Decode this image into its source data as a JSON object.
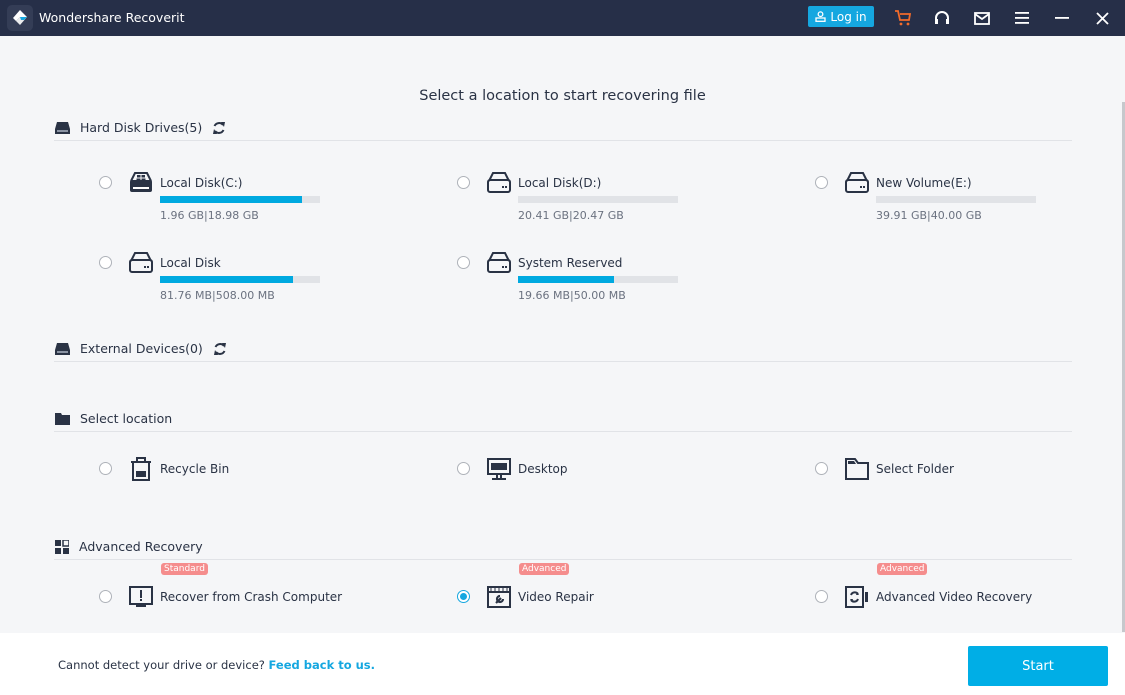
{
  "app": {
    "title": "Wondershare Recoverit"
  },
  "titlebar": {
    "login_label": "Log in",
    "icons": [
      "user-icon",
      "cart-icon",
      "headset-icon",
      "mail-icon",
      "menu-icon",
      "minimize-icon",
      "close-icon"
    ],
    "accent": "#15a7e0",
    "cart_color": "#f26b2a"
  },
  "main": {
    "heading": "Select a location to start recovering file"
  },
  "hard_disks": {
    "title": "Hard Disk Drives(5)",
    "drives": [
      {
        "name": "Local Disk(C:)",
        "used": "1.96 GB",
        "total": "18.98 GB",
        "size_text": "1.96 GB|18.98 GB",
        "fill_fraction": 0.89,
        "icon": "windows-drive-icon"
      },
      {
        "name": "Local Disk(D:)",
        "used": "20.41 GB",
        "total": "20.47 GB",
        "size_text": "20.41 GB|20.47 GB",
        "fill_fraction": 0.0,
        "icon": "hard-drive-icon"
      },
      {
        "name": "New Volume(E:)",
        "used": "39.91 GB",
        "total": "40.00 GB",
        "size_text": "39.91 GB|40.00 GB",
        "fill_fraction": 0.0,
        "icon": "hard-drive-icon"
      },
      {
        "name": "Local Disk",
        "used": "81.76 MB",
        "total": "508.00 MB",
        "size_text": "81.76 MB|508.00 MB",
        "fill_fraction": 0.83,
        "icon": "hard-drive-icon"
      },
      {
        "name": "System Reserved",
        "used": "19.66 MB",
        "total": "50.00 MB",
        "size_text": "19.66 MB|50.00 MB",
        "fill_fraction": 0.6,
        "icon": "hard-drive-icon"
      }
    ]
  },
  "external": {
    "title": "External Devices(0)"
  },
  "select_location": {
    "title": "Select location",
    "items": [
      {
        "label": "Recycle Bin"
      },
      {
        "label": "Desktop"
      },
      {
        "label": "Select Folder"
      }
    ]
  },
  "advanced": {
    "title": "Advanced Recovery",
    "items": [
      {
        "label": "Recover from Crash Computer",
        "badge": "Standard",
        "selected": false
      },
      {
        "label": "Video Repair",
        "badge": "Advanced",
        "selected": true
      },
      {
        "label": "Advanced Video Recovery",
        "badge": "Advanced",
        "selected": false
      }
    ]
  },
  "footer": {
    "text": "Cannot detect your drive or device?",
    "link": "Feed back to us.",
    "start_label": "Start"
  }
}
